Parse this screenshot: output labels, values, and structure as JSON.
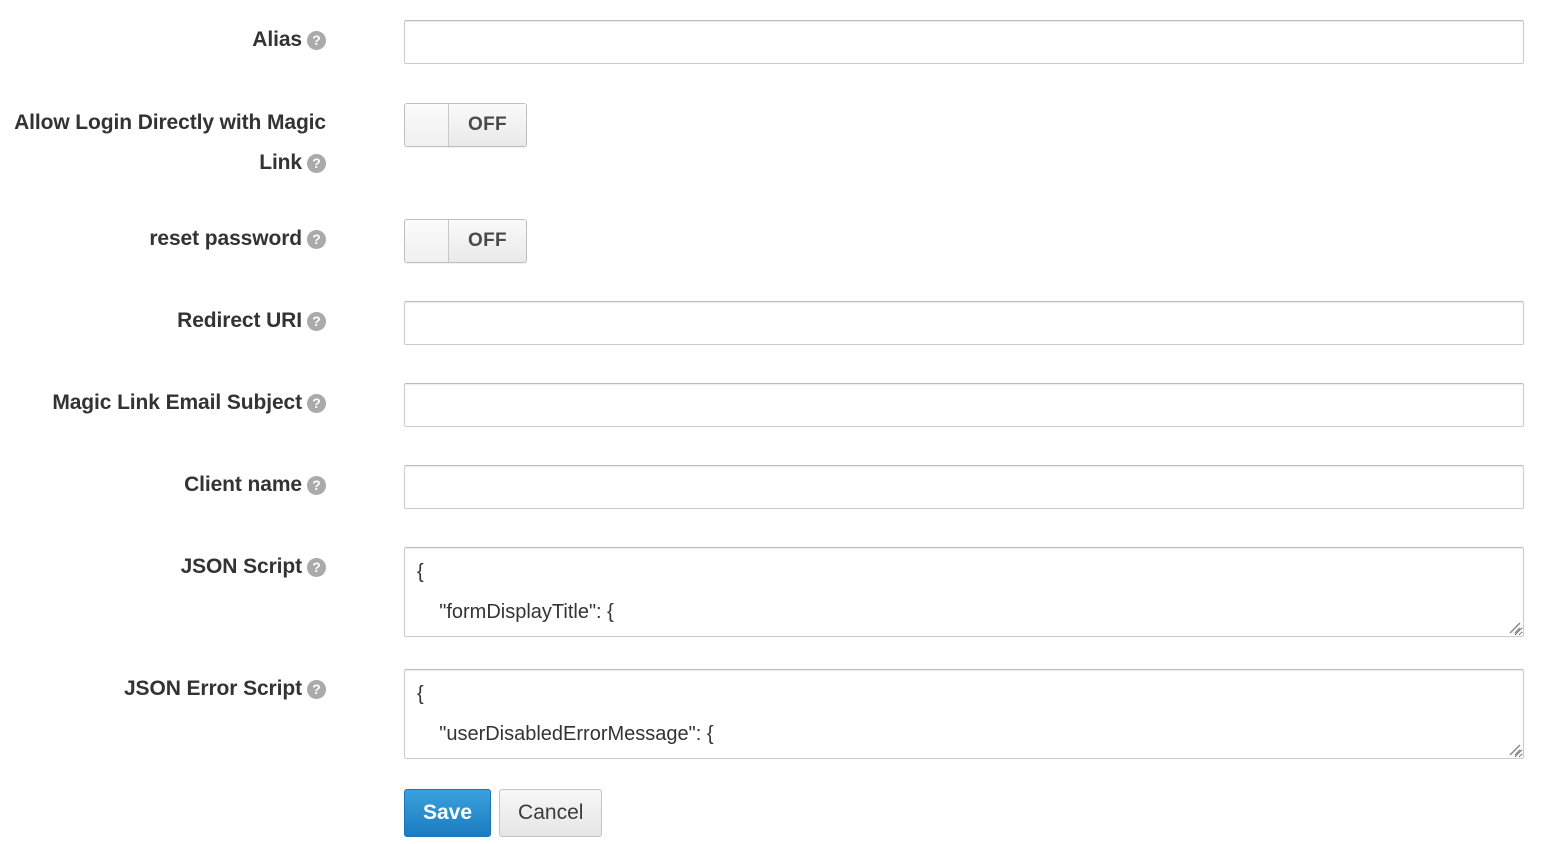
{
  "form": {
    "rows": [
      {
        "id": "alias",
        "label": "Alias",
        "help": "?",
        "type": "text",
        "value": "",
        "placeholder": ""
      },
      {
        "id": "allow-login-directly-with-magic-link",
        "label": "Allow Login Directly with Magic Link",
        "help": "?",
        "type": "toggle",
        "state": "OFF"
      },
      {
        "id": "reset-password",
        "label": "reset password",
        "help": "?",
        "type": "toggle",
        "state": "OFF"
      },
      {
        "id": "redirect-uri",
        "label": "Redirect URI",
        "help": "?",
        "type": "text",
        "value": "",
        "placeholder": ""
      },
      {
        "id": "magic-link-email-subject",
        "label": "Magic Link Email Subject",
        "help": "?",
        "type": "text",
        "value": "",
        "placeholder": ""
      },
      {
        "id": "client-name",
        "label": "Client name",
        "help": "?",
        "type": "text",
        "value": "",
        "placeholder": ""
      },
      {
        "id": "json-script",
        "label": "JSON Script",
        "help": "?",
        "type": "textarea",
        "value": "{\n    \"formDisplayTitle\": {",
        "placeholder": ""
      },
      {
        "id": "json-error-script",
        "label": "JSON Error Script",
        "help": "?",
        "type": "textarea",
        "value": "{\n    \"userDisabledErrorMessage\": {",
        "placeholder": ""
      }
    ],
    "buttons": {
      "save_label": "Save",
      "cancel_label": "Cancel"
    }
  },
  "colors": {
    "primary": "#2a8fd0",
    "primary_border": "#1a76b8",
    "text": "#333333",
    "help_icon_bg": "#aaaaaa",
    "input_border": "#cccccc",
    "toggle_text": "#4a4a4a"
  }
}
